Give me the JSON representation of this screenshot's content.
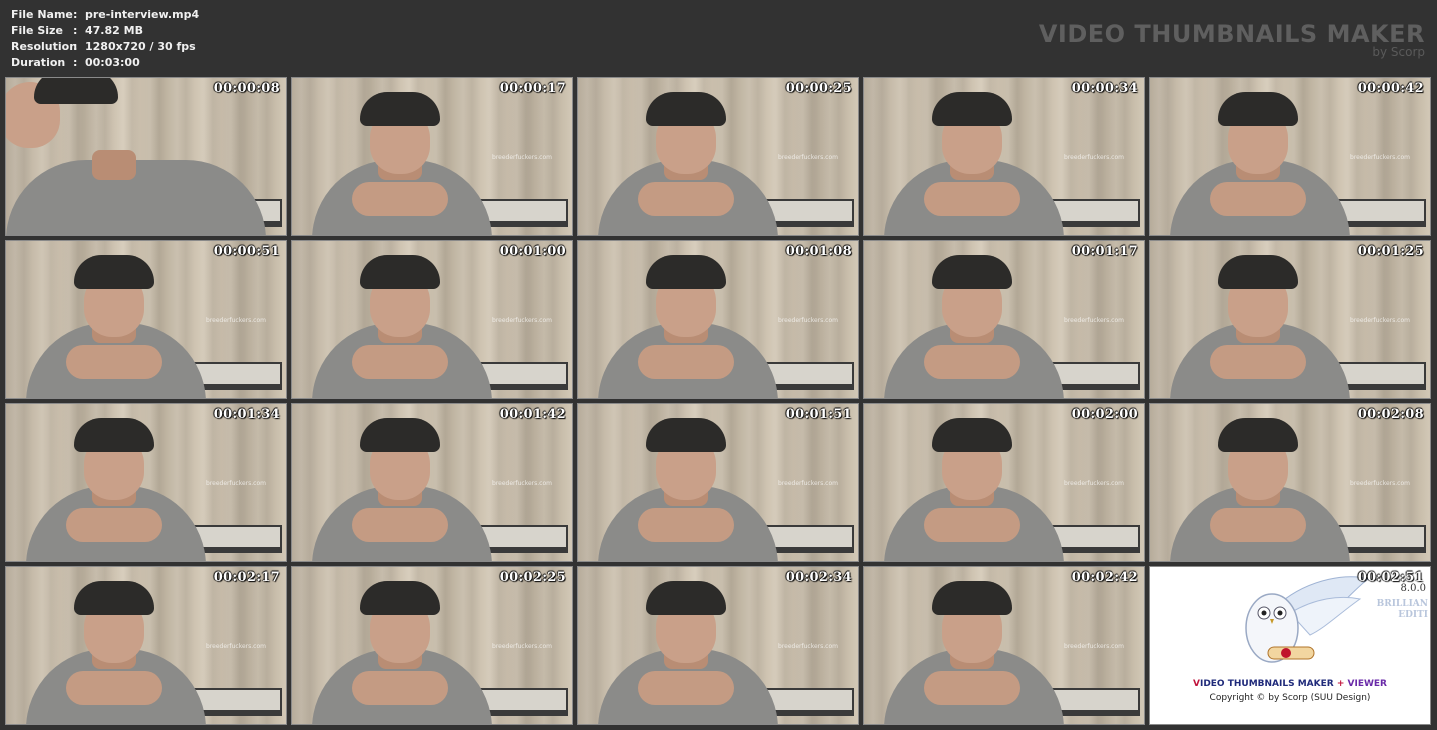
{
  "info": {
    "rows": [
      {
        "label": "File Name",
        "sep": ":",
        "value": "pre-interview.mp4"
      },
      {
        "label": "File Size",
        "sep": ":",
        "value": "47.82 MB"
      },
      {
        "label": "Resolution",
        "sep": ":",
        "value": "1280x720 / 30 fps"
      },
      {
        "label": "Duration",
        "sep": ":",
        "value": "00:03:00"
      }
    ]
  },
  "brand": {
    "title": "VIDEO THUMBNAILS MAKER",
    "subtitle": "by Scorp"
  },
  "thumbnails": [
    {
      "timestamp": "00:00:08",
      "watermark": ""
    },
    {
      "timestamp": "00:00:17",
      "watermark": "breederfuckers.com"
    },
    {
      "timestamp": "00:00:25",
      "watermark": "breederfuckers.com"
    },
    {
      "timestamp": "00:00:34",
      "watermark": "breederfuckers.com"
    },
    {
      "timestamp": "00:00:42",
      "watermark": "breederfuckers.com"
    },
    {
      "timestamp": "00:00:51",
      "watermark": "breederfuckers.com"
    },
    {
      "timestamp": "00:01:00",
      "watermark": "breederfuckers.com"
    },
    {
      "timestamp": "00:01:08",
      "watermark": "breederfuckers.com"
    },
    {
      "timestamp": "00:01:17",
      "watermark": "breederfuckers.com"
    },
    {
      "timestamp": "00:01:25",
      "watermark": "breederfuckers.com"
    },
    {
      "timestamp": "00:01:34",
      "watermark": "breederfuckers.com"
    },
    {
      "timestamp": "00:01:42",
      "watermark": "breederfuckers.com"
    },
    {
      "timestamp": "00:01:51",
      "watermark": "breederfuckers.com"
    },
    {
      "timestamp": "00:02:00",
      "watermark": "breederfuckers.com"
    },
    {
      "timestamp": "00:02:08",
      "watermark": "breederfuckers.com"
    },
    {
      "timestamp": "00:02:17",
      "watermark": "breederfuckers.com"
    },
    {
      "timestamp": "00:02:25",
      "watermark": "breederfuckers.com"
    },
    {
      "timestamp": "00:02:34",
      "watermark": "breederfuckers.com"
    },
    {
      "timestamp": "00:02:42",
      "watermark": "breederfuckers.com"
    }
  ],
  "logo_tile": {
    "timestamp": "00:02:51",
    "version": "8.0.0",
    "edition_line1": "BRILLIAN",
    "edition_line2": "EDITI",
    "product_v": "V",
    "product_rest": "IDEO THUMBNAILS MAKER",
    "product_plus": "+",
    "product_viewer": "VIEWER",
    "copyright": "Copyright © by Scorp (SUU Design)"
  },
  "colors": {
    "background": "#323232",
    "brand_text": "#5f5f5f",
    "info_text": "#f0f0f0"
  }
}
